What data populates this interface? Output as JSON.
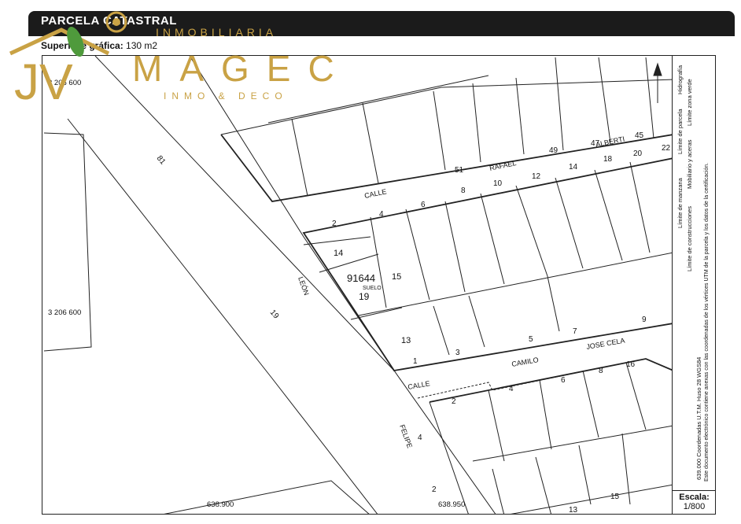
{
  "header": {
    "title": "PARCELA CATASTRAL",
    "surface_label": "Superficie gráfica:",
    "surface_value": "130 m2"
  },
  "logo": {
    "initials": "JV",
    "top_text": "INMOBILIARIA",
    "brand": "MAGEC",
    "bottom_text": "INMO & DECO",
    "gold_color": "#c9a245",
    "leaf_color": "#4f9a3c"
  },
  "map": {
    "parcel_ref": "91644",
    "parcel_sub": "SUELO",
    "parcel_number": "19",
    "streets": {
      "calle_top": "CALLE",
      "rafael": "RAFAEL",
      "alberti": "ALBERTI",
      "leon": "LEÓN",
      "calle_bottom": "CALLE",
      "camilo": "CAMILO",
      "jose_cela": "JOSE CELA",
      "felipe": "FELIPE"
    },
    "house_numbers": {
      "n51": "51",
      "n49": "49",
      "n47": "47",
      "n45": "45",
      "n8": "8",
      "n10": "10",
      "n12": "12",
      "n14": "14",
      "n18": "18",
      "n20": "20",
      "n22": "22",
      "n2a": "2",
      "n4a": "4",
      "n6a": "6",
      "n14p": "14",
      "n15p": "15",
      "n13p": "13",
      "n1": "1",
      "n3": "3",
      "n5": "5",
      "n7": "7",
      "n9": "9",
      "n2b": "2",
      "n4b": "4",
      "n6b": "6",
      "n8b": "8",
      "n16": "16",
      "n81": "81",
      "n19": "19",
      "n4c": "4",
      "n2c": "2",
      "n13b": "13",
      "n15b": "15"
    },
    "coords": {
      "y_top": "3 206 600",
      "y_mid": "3 206 600",
      "x_left": "638.900",
      "x_mid": "638.950"
    }
  },
  "legend": {
    "line1a": "Límite de manzana",
    "line1b": "Límite de parcela",
    "line1c": "Hidrografía",
    "line2a": "Límite de construcciones",
    "line2b": "Mobiliario y aceras",
    "line2c": "Límite zona verde",
    "coords_note": "639.000 Coordenadas U.T.M. Huso 28 WGS84",
    "doc_note": "Este documento electrónico contiene anexas con las coordenadas de los vértices UTM de la parcela y los datos de la certificación."
  },
  "scale": {
    "label": "Escala:",
    "value": "1/800"
  }
}
